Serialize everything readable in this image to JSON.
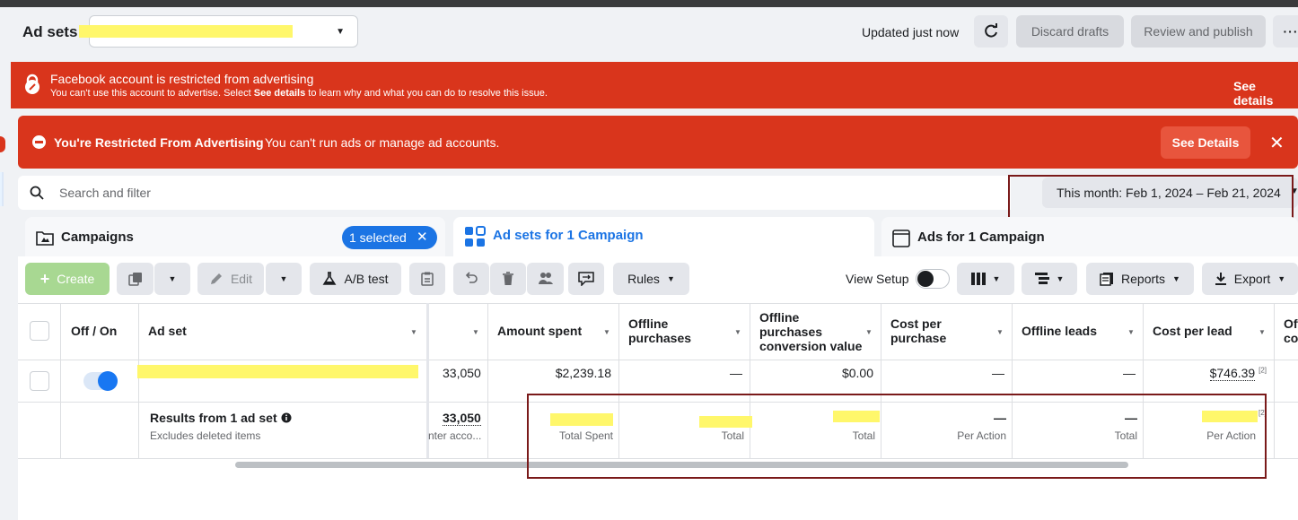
{
  "header": {
    "title": "Ad sets",
    "updated": "Updated just now",
    "discard": "Discard drafts",
    "review": "Review and publish",
    "more": "···"
  },
  "banner_account": {
    "title": "Facebook account is restricted from advertising",
    "msg_prefix": "You can't use this account to advertise. Select",
    "msg_link": "See details",
    "msg_suffix": "to learn why and what you can do to resolve this issue.",
    "see_details": "See details"
  },
  "banner_restricted": {
    "title": "You're Restricted From Advertising",
    "message": "You can't run ads or manage ad accounts.",
    "button": "See Details",
    "close": "✕"
  },
  "search": {
    "placeholder": "Search and filter",
    "date_range": "This month: Feb 1, 2024 – Feb 21, 2024"
  },
  "tabs": {
    "campaigns": "Campaigns",
    "selected": "1 selected",
    "adsets": "Ad sets for 1 Campaign",
    "ads": "Ads for 1 Campaign"
  },
  "toolbar": {
    "create": "Create",
    "edit": "Edit",
    "ab_test": "A/B test",
    "rules": "Rules",
    "view_setup": "View Setup",
    "reports": "Reports",
    "export": "Export"
  },
  "table": {
    "headers": {
      "offon": "Off / On",
      "adset": "Ad set",
      "amount_spent": "Amount spent",
      "offline_purchases_1": "Offline",
      "offline_purchases_2": "purchases",
      "opcv_1": "Offline",
      "opcv_2": "purchases",
      "opcv_3": "conversion value",
      "cpp_1": "Cost per",
      "cpp_2": "purchase",
      "offline_leads": "Offline leads",
      "cost_per_lead": "Cost per lead",
      "cut_1": "Off",
      "cut_2": "co"
    },
    "row": {
      "hidden_col": "33,050",
      "amount_spent": "$2,239.18",
      "offline_purchases": "—",
      "opcv": "$0.00",
      "cpp": "—",
      "offline_leads": "—",
      "cost_per_lead": "$746.39",
      "cpl_note": "[2]"
    },
    "summary": {
      "title": "Results from 1 ad set",
      "subtitle": "Excludes deleted items",
      "hidden_col": "33,050",
      "hidden_sub": "nter acco...",
      "amount_sub": "Total Spent",
      "op_sub": "Total",
      "opcv_sub": "Total",
      "cpp_val": "—",
      "cpp_sub": "Per Action",
      "leads_val": "—",
      "leads_sub": "Total",
      "cpl_note": "[2]",
      "cpl_sub": "Per Action"
    }
  }
}
